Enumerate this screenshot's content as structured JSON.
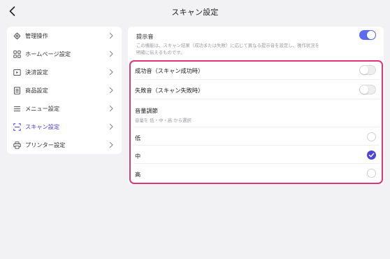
{
  "header": {
    "title": "スキャン設定"
  },
  "sidebar": {
    "items": [
      {
        "label": "管理操作"
      },
      {
        "label": "ホームページ設定"
      },
      {
        "label": "決済設定"
      },
      {
        "label": "商品設定"
      },
      {
        "label": "メニュー設定"
      },
      {
        "label": "スキャン設定",
        "active": true
      },
      {
        "label": "プリンター設定"
      }
    ]
  },
  "main": {
    "prompt_sound": {
      "title": "提示音",
      "description": "この機能は、スキャン結果（成功または失敗）に応じて異なる提示音を設定し、操作状況を明確に伝えるものです。",
      "enabled": true
    },
    "success_sound": {
      "label": "成功音（スキャン成功時）",
      "enabled": false
    },
    "failure_sound": {
      "label": "失敗音（スキャン失敗時）",
      "enabled": false
    },
    "volume": {
      "title": "音量調節",
      "hint": "音量を 低・中・高 から選択",
      "options": [
        "低",
        "中",
        "高"
      ],
      "selected": "中"
    }
  },
  "colors": {
    "accent": "#4b45d8",
    "toggle_on": "#5c6bf0",
    "highlight": "#e0357a",
    "background": "#f2f2f4"
  }
}
